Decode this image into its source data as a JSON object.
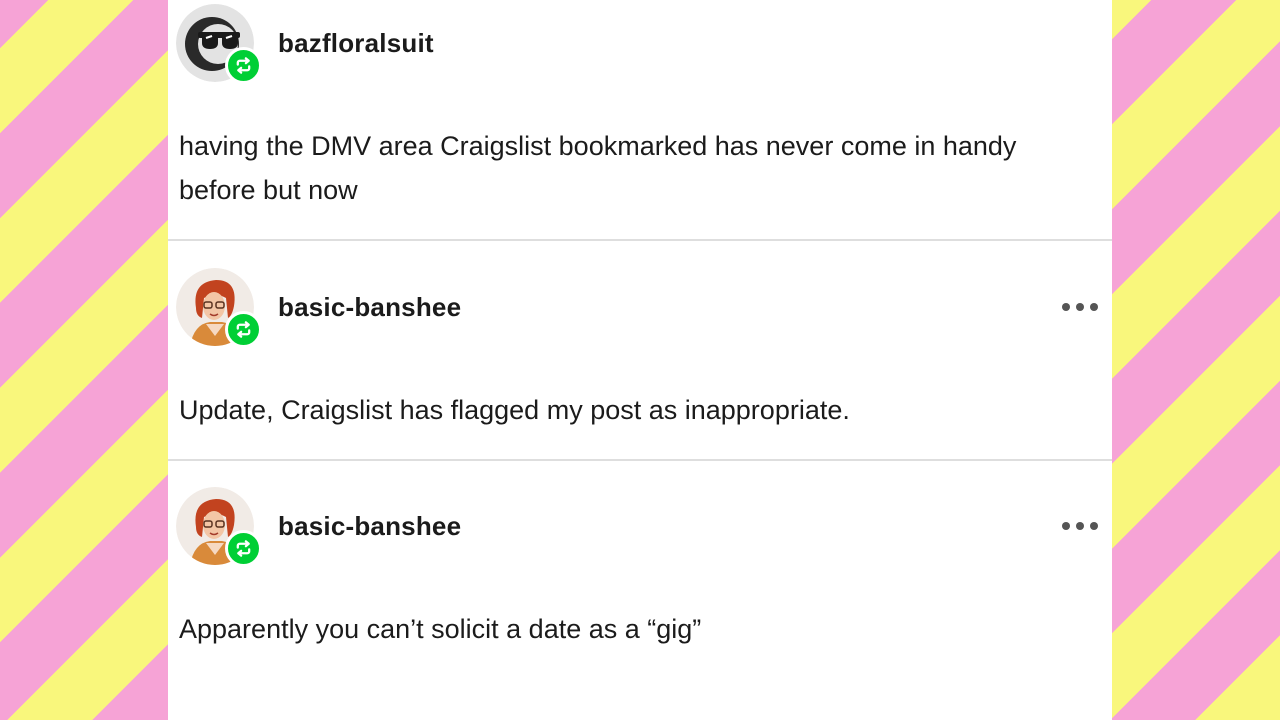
{
  "posts": [
    {
      "username": "bazfloralsuit",
      "text": "having the DMV area Craigslist bookmarked has never come in handy before but now",
      "avatar_icon": "sunglasses-avatar-icon",
      "badge_icon": "reblog-icon",
      "has_more_menu": false
    },
    {
      "username": "basic-banshee",
      "text": "Update, Craigslist has flagged my post as inappropriate.",
      "avatar_icon": "redhead-portrait-avatar-icon",
      "badge_icon": "reblog-icon",
      "has_more_menu": true
    },
    {
      "username": "basic-banshee",
      "text": "Apparently you can’t solicit a date as a “gig”",
      "avatar_icon": "redhead-portrait-avatar-icon",
      "badge_icon": "reblog-icon",
      "has_more_menu": true
    }
  ],
  "colors": {
    "stripe_yellow": "#f9f77c",
    "stripe_pink": "#f6a3d6",
    "reblog_green": "#00cf35",
    "text": "#1b1b1b"
  }
}
